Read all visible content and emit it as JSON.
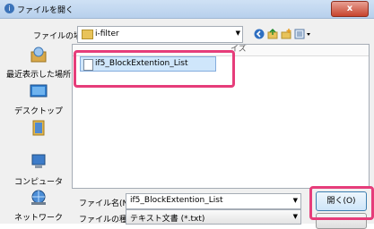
{
  "window": {
    "title": "ファイルを開く",
    "close_label": "x"
  },
  "location": {
    "label": "ファイルの場所(I):",
    "value": "i-filter"
  },
  "filelist": {
    "size_column": "イズ",
    "file": "if5_BlockExtention_List"
  },
  "sidebar": {
    "items": [
      {
        "label": "最近表示した場所",
        "icon": "recent-places-icon"
      },
      {
        "label": "デスクトップ",
        "icon": "desktop-icon"
      },
      {
        "label": "",
        "icon": "user-folder-icon"
      },
      {
        "label": "コンピュータ",
        "icon": "computer-icon"
      },
      {
        "label": "ネットワーク",
        "icon": "network-icon"
      }
    ]
  },
  "filename": {
    "label": "ファイル名(N):",
    "value": "if5_BlockExtention_List"
  },
  "filetype": {
    "label": "ファイルの種類(T):",
    "value": "テキスト文書 (*.txt)"
  },
  "buttons": {
    "open": "開く(O)"
  },
  "colors": {
    "highlight": "#e63d7a",
    "selection": "#cfe6fb"
  }
}
